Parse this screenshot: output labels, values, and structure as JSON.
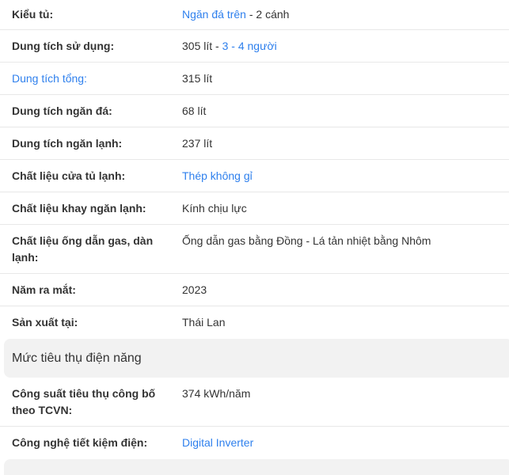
{
  "rows1": [
    {
      "label": "Kiểu tủ:",
      "value_link": "Ngăn đá trên",
      "value_text": " - 2 cánh"
    },
    {
      "label": "Dung tích sử dụng:",
      "value_text": "305 lít - ",
      "value_link": "3 - 4 người"
    },
    {
      "label": "Dung tích tổng:",
      "value_text": "315 lít"
    },
    {
      "label": "Dung tích ngăn đá:",
      "value_text": "68 lít"
    },
    {
      "label": "Dung tích ngăn lạnh:",
      "value_text": "237 lít"
    },
    {
      "label": "Chất liệu cửa tủ lạnh:",
      "value_link": "Thép không gỉ"
    },
    {
      "label": "Chất liệu khay ngăn lạnh:",
      "value_text": "Kính chịu lực"
    },
    {
      "label": "Chất liệu ống dẫn gas, dàn lạnh:",
      "value_text": "Ống dẫn gas bằng Đồng - Lá tản nhiệt bằng Nhôm"
    },
    {
      "label": "Năm ra mắt:",
      "value_text": "2023"
    },
    {
      "label": "Sản xuất tại:",
      "value_text": "Thái Lan"
    }
  ],
  "section": {
    "title": "Mức tiêu thụ điện năng"
  },
  "rows2": [
    {
      "label": "Công suất tiêu thụ công bố theo TCVN:",
      "value_text": "374 kWh/năm"
    },
    {
      "label": "Công nghệ tiết kiệm điện:",
      "value_link": "Digital Inverter"
    }
  ],
  "colors": {
    "link": "#2f80ed",
    "section_bg": "#f2f2f2",
    "divider": "#e8e8e8"
  }
}
